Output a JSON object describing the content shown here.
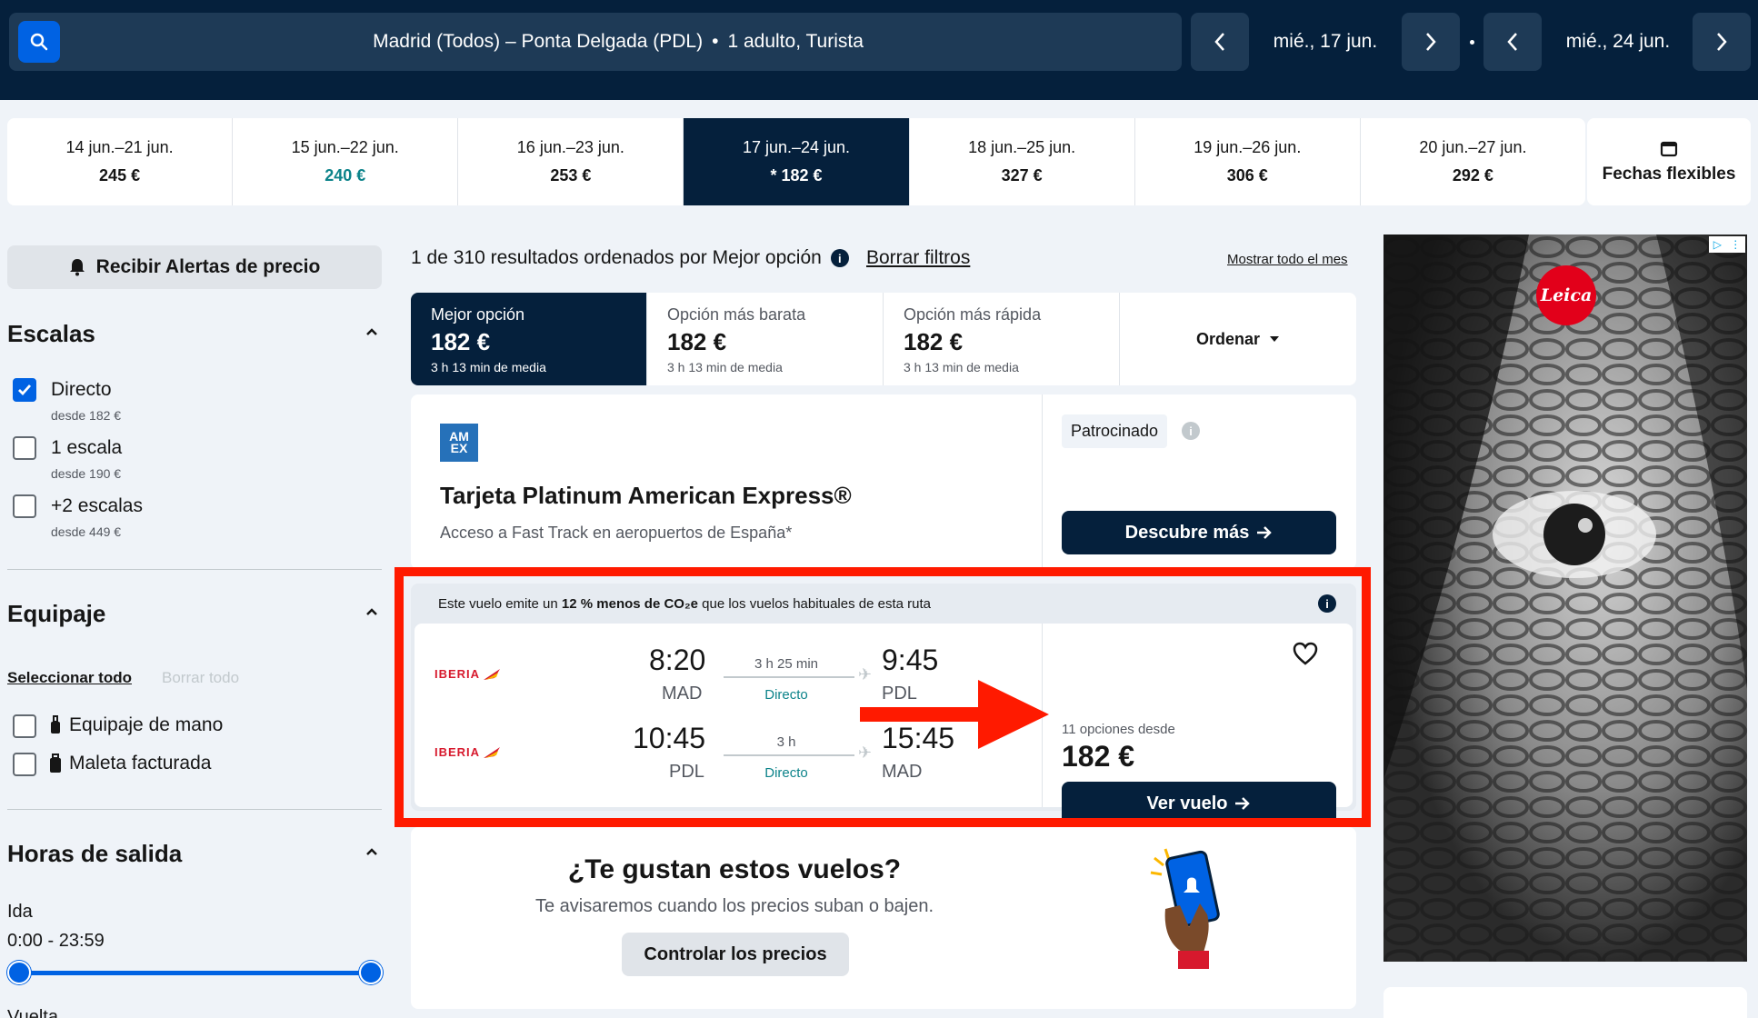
{
  "header": {
    "search_summary": "Madrid (Todos) – Ponta Delgada (PDL)",
    "passengers": "1 adulto, Turista",
    "depart_date": "mié., 17 jun.",
    "return_date": "mié., 24 jun."
  },
  "date_strip": [
    {
      "range": "14 jun.–21 jun.",
      "price": "245 €"
    },
    {
      "range": "15 jun.–22 jun.",
      "price": "240 €"
    },
    {
      "range": "16 jun.–23 jun.",
      "price": "253 €"
    },
    {
      "range": "17 jun.–24 jun.",
      "price": "* 182 €"
    },
    {
      "range": "18 jun.–25 jun.",
      "price": "327 €"
    },
    {
      "range": "19 jun.–26 jun.",
      "price": "306 €"
    },
    {
      "range": "20 jun.–27 jun.",
      "price": "292 €"
    }
  ],
  "flexible_dates": "Fechas flexibles",
  "sidebar": {
    "alerts_button": "Recibir Alertas de precio",
    "stops_title": "Escalas",
    "stops": [
      {
        "label": "Directo",
        "sub": "desde 182 €",
        "checked": true
      },
      {
        "label": "1 escala",
        "sub": "desde 190 €",
        "checked": false
      },
      {
        "label": "+2 escalas",
        "sub": "desde 449 €",
        "checked": false
      }
    ],
    "baggage_title": "Equipaje",
    "select_all": "Seleccionar todo",
    "clear_all": "Borrar todo",
    "baggage": [
      "Equipaje de mano",
      "Maleta facturada"
    ],
    "times_title": "Horas de salida",
    "outbound_label": "Ida",
    "outbound_range": "0:00 - 23:59",
    "return_label": "Vuelta"
  },
  "results": {
    "summary": "1 de 310 resultados ordenados por Mejor opción",
    "clear_filters": "Borrar filtros",
    "show_month": "Mostrar todo el mes",
    "sort_tabs": [
      {
        "title": "Mejor opción",
        "price": "182 €",
        "sub": "3 h 13 min de media"
      },
      {
        "title": "Opción más barata",
        "price": "182 €",
        "sub": "3 h 13 min de media"
      },
      {
        "title": "Opción más rápida",
        "price": "182 €",
        "sub": "3 h 13 min de media"
      }
    ],
    "sort_label": "Ordenar"
  },
  "ad_card": {
    "logo_text": "AM EX",
    "title": "Tarjeta Platinum American Express®",
    "subtitle": "Acceso a Fast Track en aeropuertos de España*",
    "sponsored": "Patrocinado",
    "cta": "Descubre más"
  },
  "flight": {
    "co2_pre": "Este vuelo emite un ",
    "co2_bold": "12 % menos de CO₂e",
    "co2_post": " que los vuelos habituales de esta ruta",
    "airline": "IBERIA",
    "legs": [
      {
        "dep_time": "8:20",
        "dep_code": "MAD",
        "duration": "3 h 25 min",
        "stops": "Directo",
        "arr_time": "9:45",
        "arr_code": "PDL"
      },
      {
        "dep_time": "10:45",
        "dep_code": "PDL",
        "duration": "3 h",
        "stops": "Directo",
        "arr_time": "15:45",
        "arr_code": "MAD"
      }
    ],
    "options": "11 opciones desde",
    "price": "182 €",
    "cta": "Ver vuelo"
  },
  "likes": {
    "title": "¿Te gustan estos vuelos?",
    "subtitle": "Te avisaremos cuando los precios suban o bajen.",
    "cta": "Controlar los precios"
  },
  "banner": {
    "brand": "Leica"
  },
  "colors": {
    "navy": "#05203c",
    "blue": "#0062e3",
    "teal": "#0c838a",
    "highlight_red": "#ff1a00"
  }
}
